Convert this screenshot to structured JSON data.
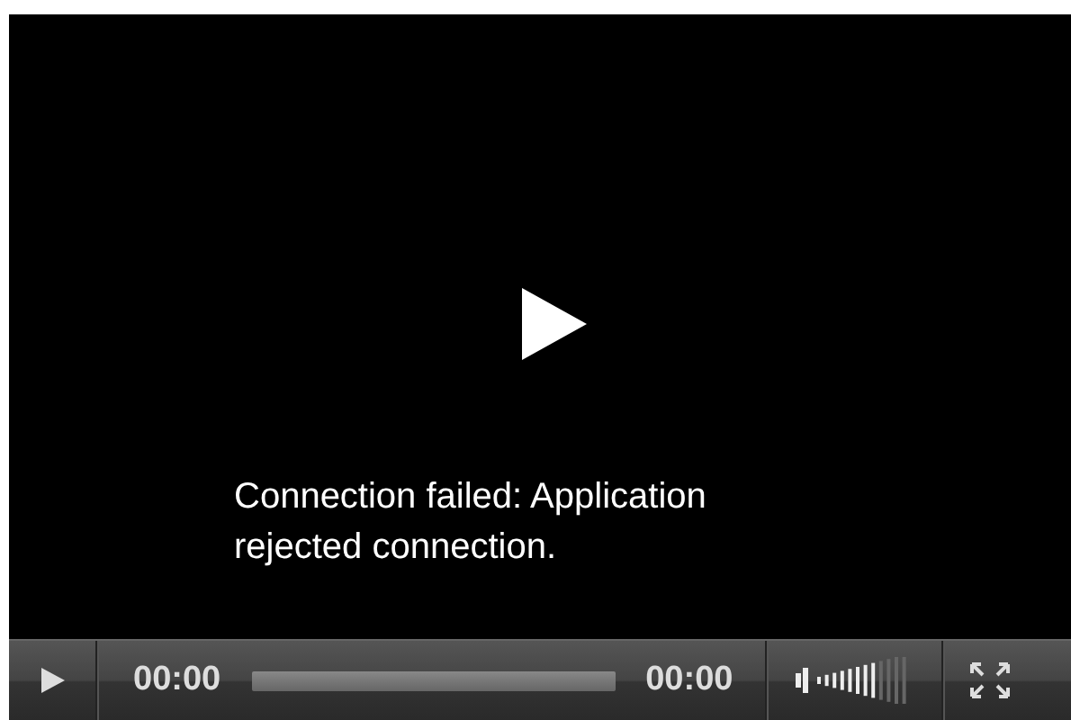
{
  "player": {
    "message": "Connection failed: Application rejected connection.",
    "controls": {
      "current_time": "00:00",
      "duration": "00:00",
      "volume": {
        "level": 0.7
      }
    }
  }
}
